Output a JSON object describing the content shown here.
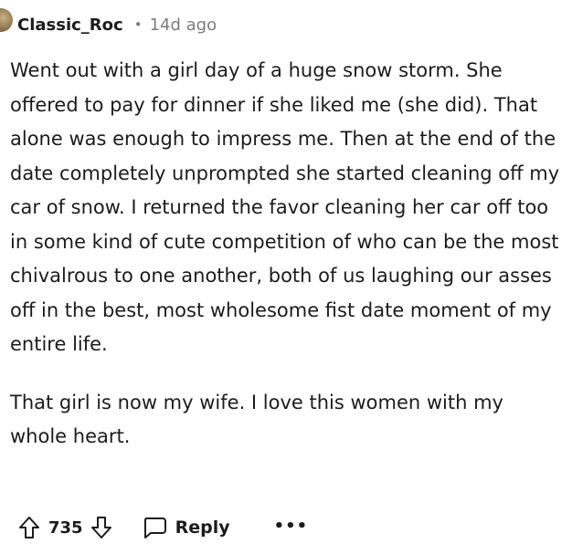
{
  "comment": {
    "author": "Classic_Roc",
    "separator": "•",
    "time": "14d ago",
    "paragraphs": [
      "Went out with a girl day of a huge snow storm. She offered to pay for dinner if she liked me (she did). That alone was enough to impress me. Then at the end of the date completely unprompted she started cleaning off my car of snow. I returned the favor cleaning her car off too in some kind of cute competition of who can be the most chivalrous to one another, both of us laughing our asses off in the best, most wholesome fist date moment of my entire life.",
      "That girl is now my wife. I love this women with my whole heart."
    ]
  },
  "actions": {
    "upvote_icon": "upvote-arrow-icon",
    "vote_count": "735",
    "downvote_icon": "downvote-arrow-icon",
    "reply_icon": "speech-bubble-icon",
    "reply_label": "Reply",
    "more_label": "•••"
  }
}
